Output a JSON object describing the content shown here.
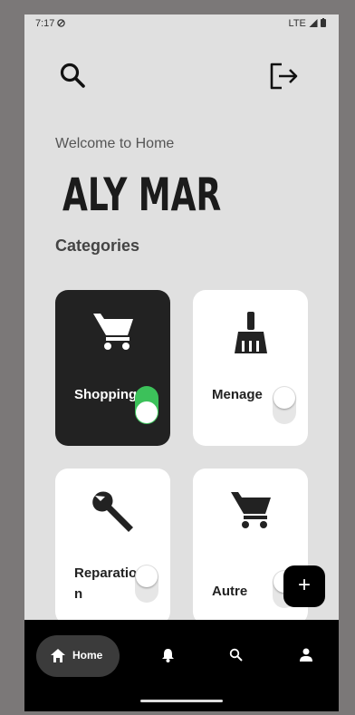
{
  "status": {
    "time": "7:17",
    "signal": "LTE"
  },
  "welcome": "Welcome to Home",
  "user_name": "ALY MAR",
  "section_title": "Categories",
  "categories": [
    {
      "label": "Shopping",
      "icon": "cart-icon",
      "selected": true,
      "enabled": true
    },
    {
      "label": "Menage",
      "icon": "broom-icon",
      "selected": false,
      "enabled": false
    },
    {
      "label": "Reparation",
      "icon": "wrench-icon",
      "selected": false,
      "enabled": false
    },
    {
      "label": "Autre",
      "icon": "cart-icon",
      "selected": false,
      "enabled": false
    }
  ],
  "fab": {
    "symbol": "+"
  },
  "nav": {
    "active": "Home",
    "items": [
      {
        "label": "Home",
        "icon": "home-icon"
      },
      {
        "label": "",
        "icon": "bell-icon"
      },
      {
        "label": "",
        "icon": "search-icon"
      },
      {
        "label": "",
        "icon": "person-icon"
      }
    ]
  },
  "colors": {
    "background": "#e0e0e0",
    "card_active": "#222222",
    "toggle_on": "#3cc15a",
    "nav_bar": "#000000"
  }
}
